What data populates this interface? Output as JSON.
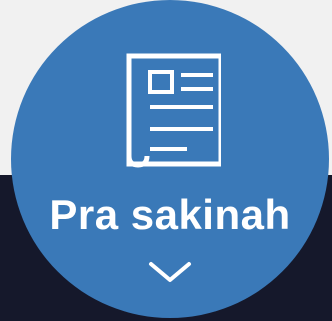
{
  "button": {
    "label": "Pra sakinah",
    "icon": "newspaper-icon",
    "expand_icon": "chevron-down-icon"
  },
  "colors": {
    "button_bg": "#3a79b8",
    "background_top": "#f1f1f1",
    "background_bottom": "#15182b",
    "foreground": "#ffffff"
  }
}
